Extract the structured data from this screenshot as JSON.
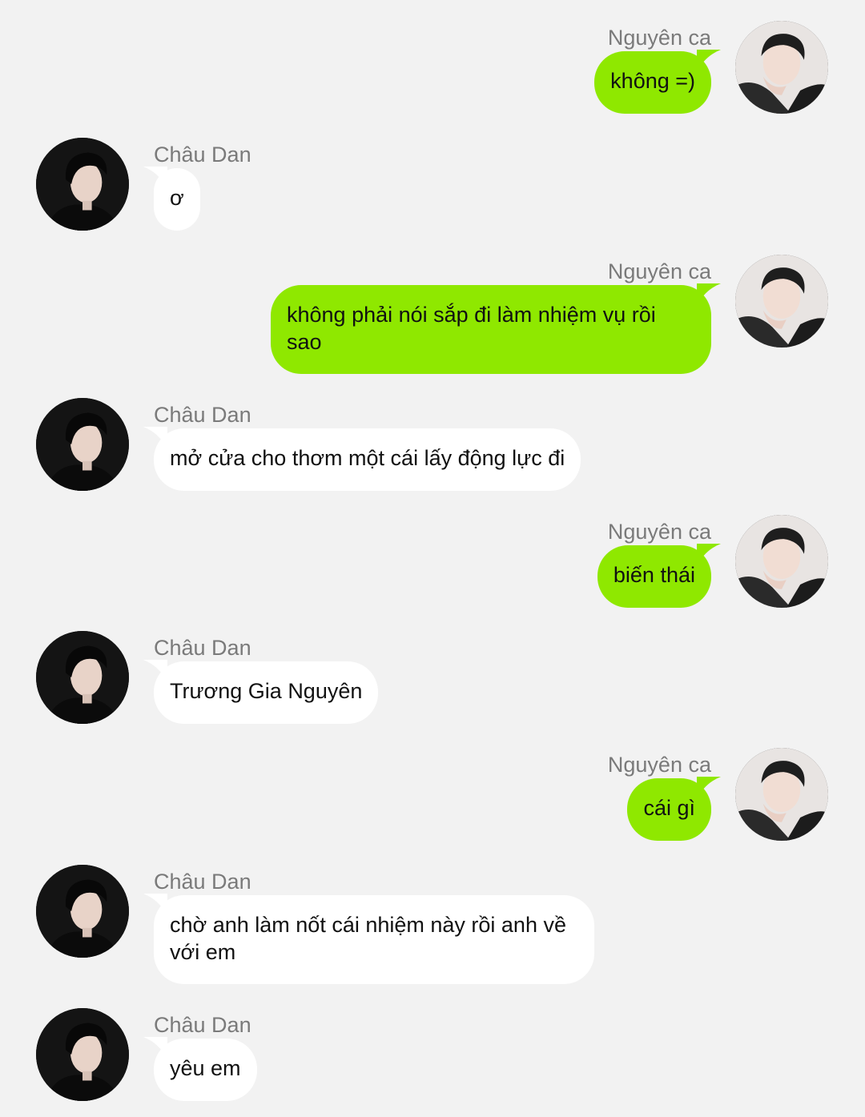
{
  "contacts": {
    "me": {
      "name": "Nguyên ca",
      "bubble_color": "#8fe800"
    },
    "them": {
      "name": "Châu Dan",
      "bubble_color": "#ffffff"
    }
  },
  "messages": [
    {
      "sender": "me",
      "name": "Nguyên ca",
      "text": "không =)"
    },
    {
      "sender": "them",
      "name": "Châu Dan",
      "text": "ơ"
    },
    {
      "sender": "me",
      "name": "Nguyên ca",
      "text": "không phải nói sắp đi làm nhiệm vụ rồi sao"
    },
    {
      "sender": "them",
      "name": "Châu Dan",
      "text": "mở cửa cho thơm một cái lấy động lực đi"
    },
    {
      "sender": "me",
      "name": "Nguyên ca",
      "text": "biến thái"
    },
    {
      "sender": "them",
      "name": "Châu Dan",
      "text": "Trương Gia Nguyên"
    },
    {
      "sender": "me",
      "name": "Nguyên ca",
      "text": "cái gì"
    },
    {
      "sender": "them",
      "name": "Châu Dan",
      "text": "chờ anh làm nốt cái nhiệm này rồi anh về với em"
    },
    {
      "sender": "them",
      "name": "Châu Dan",
      "text": "yêu em"
    }
  ]
}
